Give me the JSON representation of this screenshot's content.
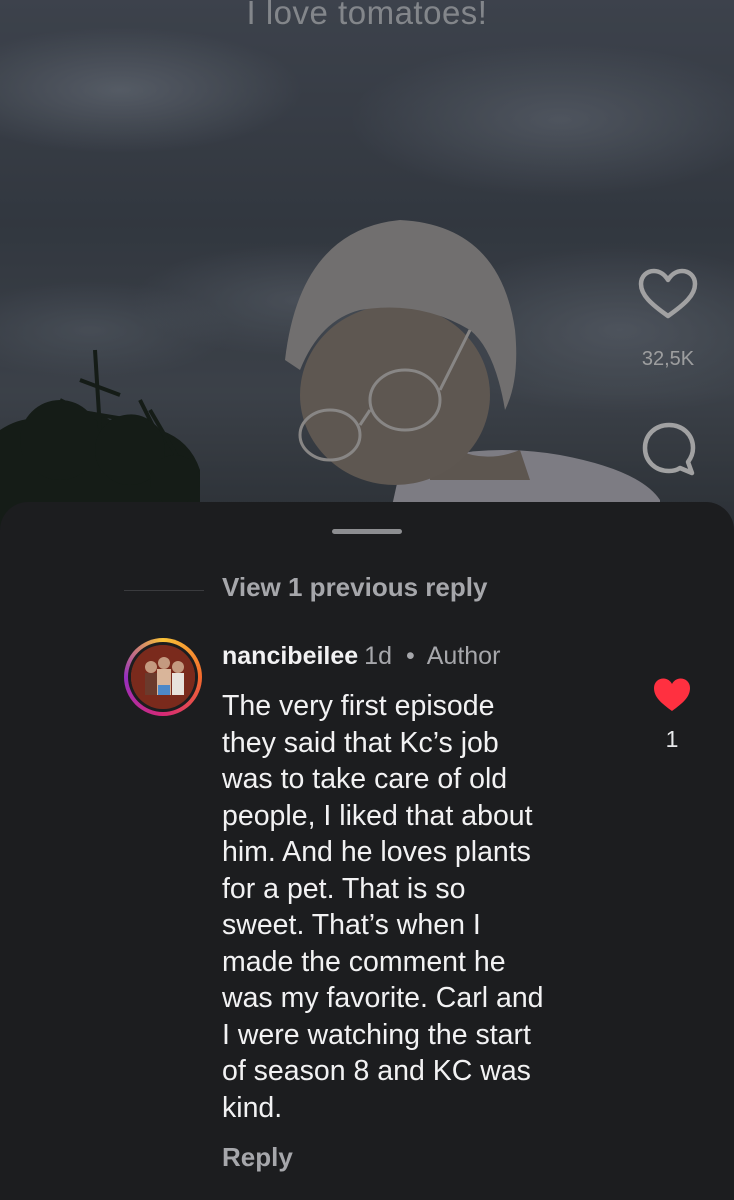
{
  "video": {
    "caption": "I love tomatoes!",
    "like_count": "32,5K"
  },
  "comments": {
    "view_previous": "View 1 previous reply",
    "items": [
      {
        "username": "nancibeilee",
        "time": "1d",
        "separator": "•",
        "badge": "Author",
        "text": "The very first episode\nthey said that Kc’s job\nwas to take care of old\npeople, I liked that about\nhim. And he loves plants\nfor a pet. That is so\nsweet. That’s when I\nmade the comment he\nwas my favorite. Carl and\nI were watching the start\nof season 8 and KC was\nkind.",
        "like_count": "1",
        "reply_label": "Reply",
        "liked": true
      }
    ]
  },
  "colors": {
    "sheet_bg": "#1c1d1f",
    "heart_red": "#ff3040",
    "muted_text": "#a6a7ab",
    "primary_text": "#f2f2f3"
  },
  "icons": [
    "heart-outline-icon",
    "comment-bubble-icon",
    "heart-filled-icon"
  ]
}
